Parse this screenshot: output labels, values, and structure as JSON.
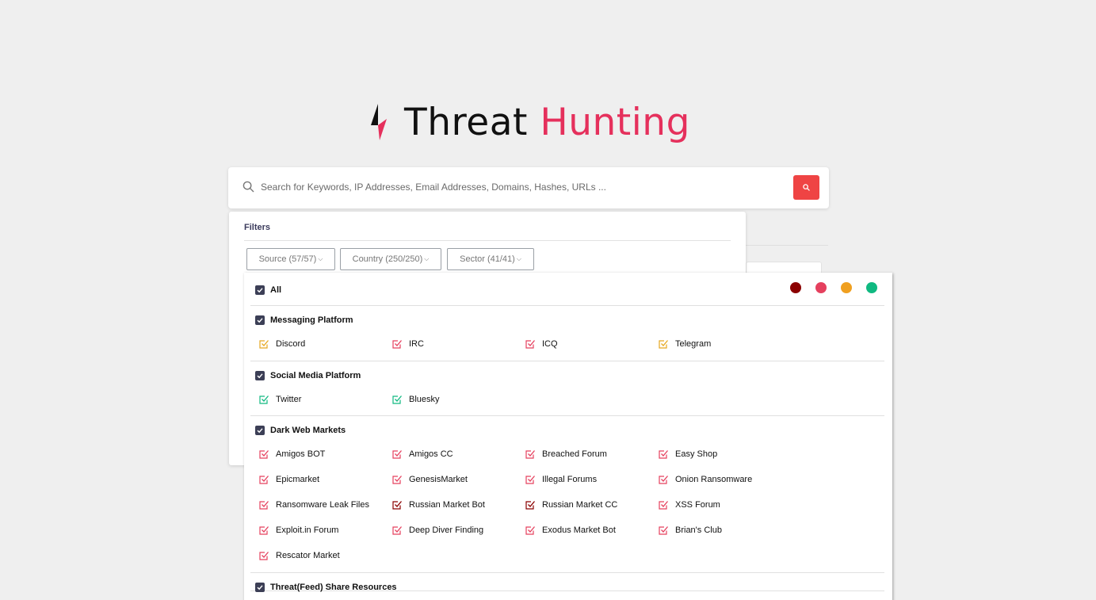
{
  "logo": {
    "word1": "Threat",
    "word2": "Hunting",
    "icon": "lightning-bolt-icon"
  },
  "search": {
    "placeholder": "Search for Keywords, IP Addresses, Email Addresses, Domains, Hashes, URLs ...",
    "value": "",
    "icon": "search-icon",
    "button_icon": "search-icon"
  },
  "filters": {
    "title": "Filters",
    "buttons": [
      {
        "label": "Source (57/57)"
      },
      {
        "label": "Country (250/250)"
      },
      {
        "label": "Sector (41/41)"
      }
    ]
  },
  "dropdown": {
    "all_label": "All",
    "legend_colors": [
      "#8b0000",
      "#e5405e",
      "#f0a020",
      "#10b981"
    ],
    "categories": [
      {
        "name": "Messaging Platform",
        "items": [
          {
            "label": "Discord",
            "color": "#e6a820"
          },
          {
            "label": "IRC",
            "color": "#e5405e"
          },
          {
            "label": "ICQ",
            "color": "#e5405e"
          },
          {
            "label": "Telegram",
            "color": "#e6a820"
          }
        ]
      },
      {
        "name": "Social Media Platform",
        "items": [
          {
            "label": "Twitter",
            "color": "#10b981"
          },
          {
            "label": "Bluesky",
            "color": "#10b981"
          }
        ]
      },
      {
        "name": "Dark Web Markets",
        "items": [
          {
            "label": "Amigos BOT",
            "color": "#e5405e"
          },
          {
            "label": "Amigos CC",
            "color": "#e5405e"
          },
          {
            "label": "Breached Forum",
            "color": "#e5405e"
          },
          {
            "label": "Easy Shop",
            "color": "#e5405e"
          },
          {
            "label": "Epicmarket",
            "color": "#e5405e"
          },
          {
            "label": "GenesisMarket",
            "color": "#e5405e"
          },
          {
            "label": "Illegal Forums",
            "color": "#e5405e"
          },
          {
            "label": "Onion Ransomware",
            "color": "#e5405e"
          },
          {
            "label": "Ransomware Leak Files",
            "color": "#e5405e"
          },
          {
            "label": "Russian Market Bot",
            "color": "#8b0000"
          },
          {
            "label": "Russian Market CC",
            "color": "#8b0000"
          },
          {
            "label": "XSS Forum",
            "color": "#e5405e"
          },
          {
            "label": "Exploit.in Forum",
            "color": "#e5405e"
          },
          {
            "label": "Deep Diver Finding",
            "color": "#e5405e"
          },
          {
            "label": "Exodus Market Bot",
            "color": "#e5405e"
          },
          {
            "label": "Brian's Club",
            "color": "#e5405e"
          },
          {
            "label": "Rescator Market",
            "color": "#e5405e"
          }
        ]
      },
      {
        "name": "Threat(Feed) Share Resources",
        "items": []
      }
    ]
  }
}
